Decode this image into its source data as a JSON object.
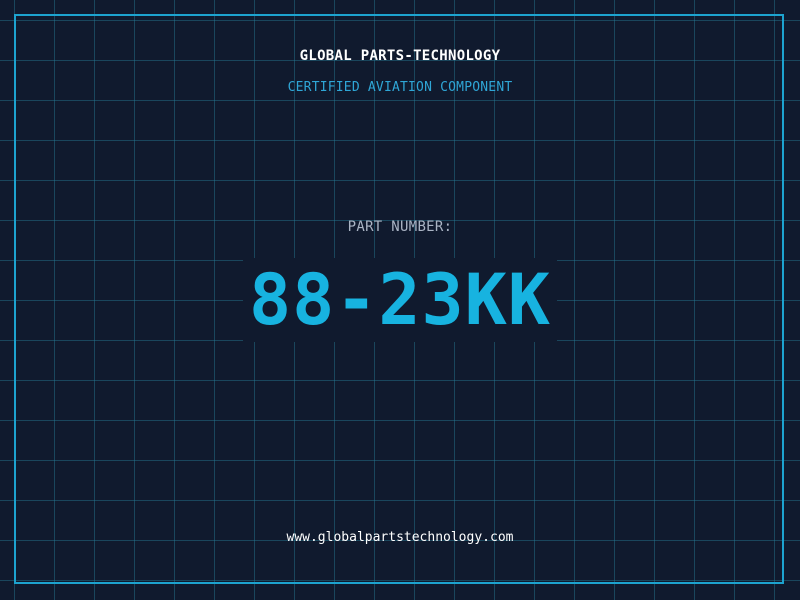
{
  "header": {
    "brand": "GLOBAL PARTS-TECHNOLOGY",
    "tagline": "CERTIFIED AVIATION COMPONENT"
  },
  "part": {
    "label": "PART NUMBER:",
    "number": "88-23KK"
  },
  "footer": {
    "website": "www.globalpartstechnology.com"
  },
  "colors": {
    "background": "#101a2e",
    "grid": "#267d96",
    "frame": "#1da3cf",
    "accent": "#17b3e0",
    "tagline": "#2fa6d6",
    "label": "#aab4c4",
    "text": "#ffffff"
  }
}
